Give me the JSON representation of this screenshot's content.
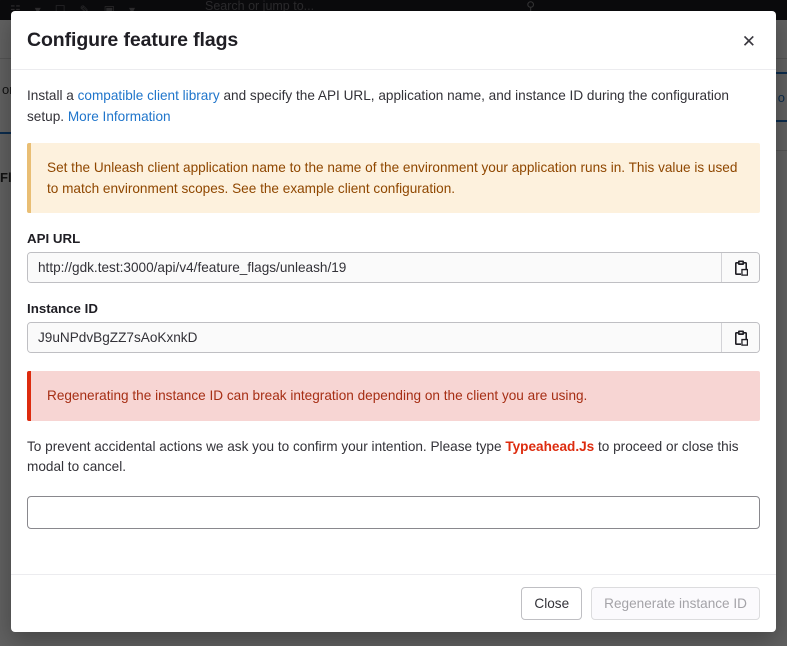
{
  "background": {
    "navbar": {
      "icons": [
        "grid-icon",
        "chevron-down-icon",
        "issues-icon",
        "merge-request-icon",
        "todo-icon",
        "chevron-down-icon"
      ],
      "search_placeholder": "Search or jump to...",
      "search_icon": "search-icon"
    },
    "left_fragments": {
      "breadcrumb_partial": "on",
      "tab_partial": "Fl"
    },
    "right_fragments": {
      "link_partial": "o"
    }
  },
  "modal": {
    "title": "Configure feature flags",
    "close_icon": "close-icon",
    "intro": {
      "lead": "Install a ",
      "link1": "compatible client library",
      "middle": " and specify the API URL, application name, and instance ID during the configuration setup. ",
      "link2": "More Information"
    },
    "warning_alert": "Set the Unleash client application name to the name of the environment your application runs in. This value is used to match environment scopes. See the example client configuration.",
    "api_url": {
      "label": "API URL",
      "value": "http://gdk.test:3000/api/v4/feature_flags/unleash/19",
      "copy_icon": "clipboard-copy-icon"
    },
    "instance_id": {
      "label": "Instance ID",
      "value": "J9uNPdvBgZZ7sAoKxnkD",
      "copy_icon": "clipboard-copy-icon"
    },
    "danger_alert": "Regenerating the instance ID can break integration depending on the client you are using.",
    "confirm": {
      "before": "To prevent accidental actions we ask you to confirm your intention. Please type ",
      "phrase": "Typeahead.Js",
      "after": " to proceed or close this modal to cancel.",
      "input_value": "",
      "input_placeholder": ""
    },
    "footer": {
      "close_label": "Close",
      "regenerate_label": "Regenerate instance ID"
    }
  },
  "colors": {
    "link": "#1f75cb",
    "danger": "#dd2b0e",
    "warning_bg": "#fdf1dd",
    "warning_border": "#e9be74",
    "danger_bg": "#f7d5d3",
    "danger_border": "#dd2b0e",
    "navbar_bg": "#1f1e24"
  }
}
